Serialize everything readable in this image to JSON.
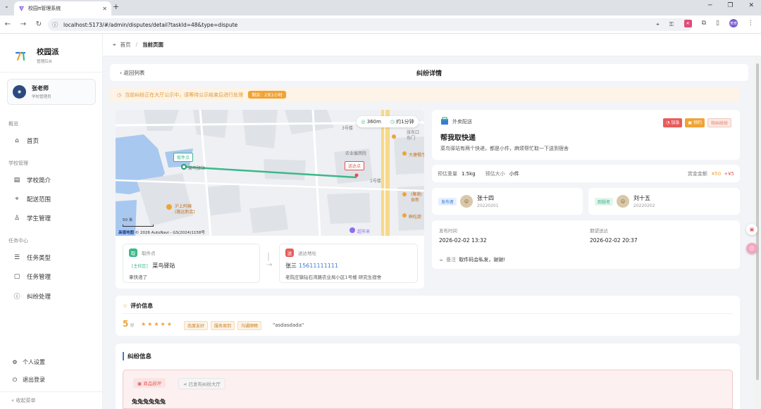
{
  "browser": {
    "tab_title": "校园π管理系统",
    "url": "localhost:5173/#/admin/disputes/detail?taskId=48&type=dispute",
    "profile_initials": "乖乖"
  },
  "sidebar": {
    "app_name": "校园派",
    "app_sub": "管理后台",
    "user_name": "张老师",
    "user_role": "学校管理员",
    "group_overview": "概览",
    "item_home": "首页",
    "group_school": "学校管理",
    "item_intro": "学校简介",
    "item_range": "配送范围",
    "item_students": "学生管理",
    "group_task": "任务中心",
    "item_types": "任务类型",
    "item_manage": "任务管理",
    "item_dispute": "纠纷处理",
    "item_settings": "个人设置",
    "item_logout": "退出登录",
    "collapse": "收起菜单"
  },
  "breadcrumb": {
    "home": "首页",
    "sep": "/",
    "current": "当前页面"
  },
  "header": {
    "back": "返回列表",
    "title": "纠纷详情"
  },
  "notice": {
    "text": "当前纠纷正在大厅公示中，请等待公示结束后进行处理",
    "remaining": "剩余：2天1小时"
  },
  "map": {
    "distance": "360m",
    "duration": "约1分钟",
    "pickup_tag": "取件点",
    "drop_tag": "送达点",
    "label_3hao": "3号楼",
    "label_door": "张东口",
    "label_door2": "东门",
    "label_agri": "农业展西院",
    "label_dasheng": "大捷餐厅",
    "label_1hao": "1号楼",
    "label_cainiao": "菜鸟驿站",
    "label_food": "(聚鼎/",
    "label_food2": "食新",
    "label_tea": "鲜吃蔬",
    "label_hotel": "沪上阿姨",
    "label_hotel2": "(路远新店)",
    "label_market": "超市来",
    "scale": "50 米",
    "brand": "高德地图",
    "copyright": "© 2026 AutoNavi - GS(2024)1158号"
  },
  "pickup": {
    "label": "取件点",
    "icon_text": "取",
    "tag": "[主校区]",
    "name": "菜鸟驿站",
    "note": "拿快递了"
  },
  "dropoff": {
    "label": "送达地址",
    "icon_text": "送",
    "receiver": "张三",
    "phone": "15611111111",
    "address": "老院庄镇钻石湾路农业局小区1号楼 研究生宿舍"
  },
  "task": {
    "type": "外卖配送",
    "tag_urgent": "加急",
    "tag_appt": "预约",
    "tag_status": "待纠纷纷",
    "title": "帮我取快递",
    "desc": "菜鸟驿站有两个快递，都是小件，麻烦帮忙取一下送到宿舍",
    "weight_label": "预估重量",
    "weight": "1.5kg",
    "size_label": "预估大小",
    "size": "小件",
    "amount_label": "赏金金额",
    "amount": "¥50",
    "extra": "+¥5"
  },
  "publisher": {
    "role": "发布者",
    "name": "张十四",
    "id": "20220201"
  },
  "runner": {
    "role": "跑腿者",
    "name": "刘十五",
    "id": "20220202"
  },
  "times": {
    "publish_label": "发布时间",
    "publish": "2026-02-02 13:32",
    "expect_label": "期望送达",
    "expect": "2026-02-02 20:37",
    "note_label": "备注",
    "note": "取件码会私发，谢谢!"
  },
  "evaluation": {
    "title": "评价信息",
    "score": "5",
    "unit": "分",
    "stars": "★★★★★",
    "tags": [
      "态度友好",
      "服务周到",
      "沟通顺畅"
    ],
    "comment": "\"asdasdada\""
  },
  "dispute": {
    "title": "纠纷信息",
    "tag1": "商品损坏",
    "tag2": "已发布纠纷大厅",
    "text": "兔兔兔兔兔兔"
  },
  "colors": {
    "accent": "#3a7bd5",
    "green": "#3cb88a",
    "orange": "#f0a335",
    "red": "#e85b5b"
  }
}
